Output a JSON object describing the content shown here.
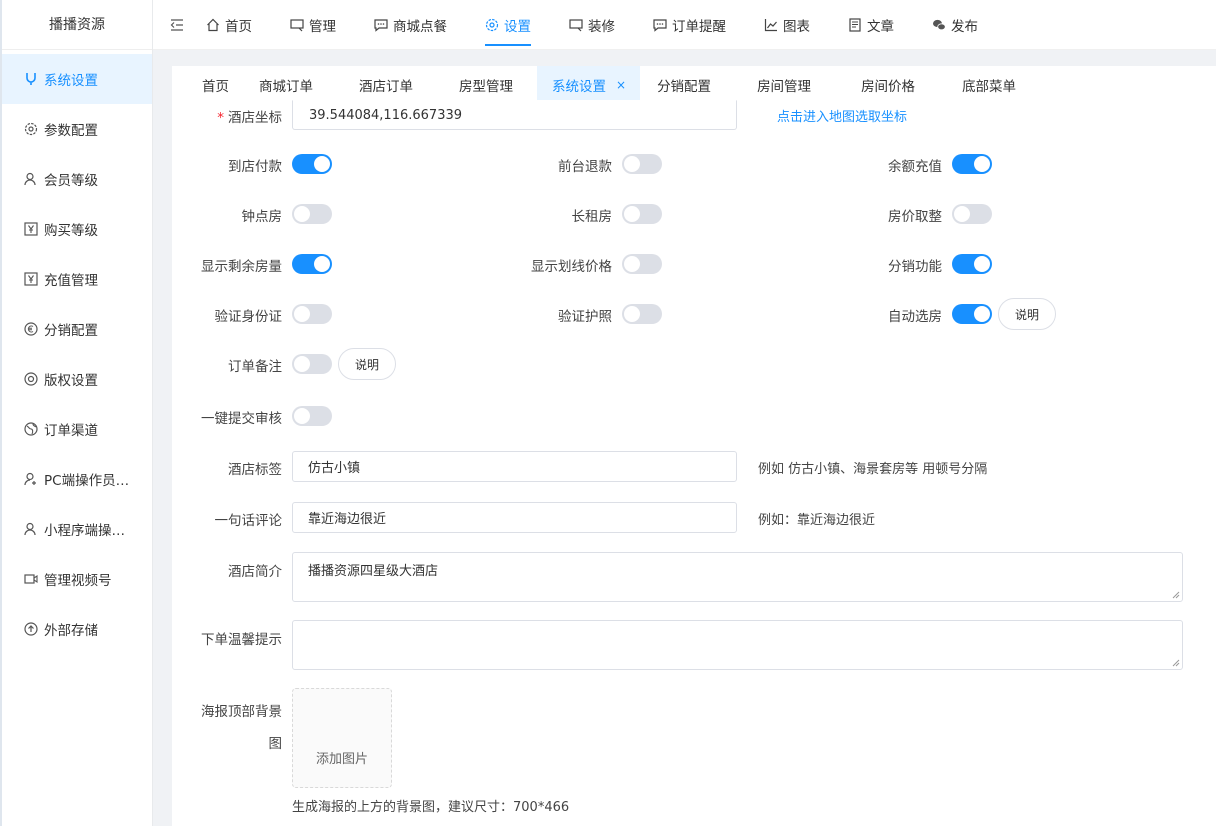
{
  "brand": "播播资源",
  "sidebar": {
    "items": [
      {
        "label": "系统设置",
        "icon": "tuning-fork-icon",
        "active": true
      },
      {
        "label": "参数配置",
        "icon": "gear-icon"
      },
      {
        "label": "会员等级",
        "icon": "user-icon"
      },
      {
        "label": "购买等级",
        "icon": "yen-box-icon"
      },
      {
        "label": "充值管理",
        "icon": "yen-box-icon"
      },
      {
        "label": "分销配置",
        "icon": "euro-circle-icon"
      },
      {
        "label": "版权设置",
        "icon": "copyright-icon"
      },
      {
        "label": "订单渠道",
        "icon": "globe-icon"
      },
      {
        "label": "PC端操作员管理",
        "icon": "user-add-icon"
      },
      {
        "label": "小程序端操作员管理",
        "icon": "user-icon"
      },
      {
        "label": "管理视频号",
        "icon": "video-icon"
      },
      {
        "label": "外部存储",
        "icon": "cloud-upload-icon"
      }
    ]
  },
  "topnav": {
    "items": [
      {
        "label": "首页",
        "icon": "home-icon"
      },
      {
        "label": "管理",
        "icon": "monitor-icon"
      },
      {
        "label": "商城点餐",
        "icon": "chat-icon"
      },
      {
        "label": "设置",
        "icon": "gear-icon",
        "active": true
      },
      {
        "label": "装修",
        "icon": "monitor-icon"
      },
      {
        "label": "订单提醒",
        "icon": "chat-icon"
      },
      {
        "label": "图表",
        "icon": "chart-icon"
      },
      {
        "label": "文章",
        "icon": "document-icon"
      },
      {
        "label": "发布",
        "icon": "wechat-icon"
      }
    ]
  },
  "tabs": [
    {
      "label": "首页"
    },
    {
      "label": "商城订单"
    },
    {
      "label": "酒店订单"
    },
    {
      "label": "房型管理"
    },
    {
      "label": "系统设置",
      "active": true,
      "close": "×"
    },
    {
      "label": "分销配置"
    },
    {
      "label": "房间管理"
    },
    {
      "label": "房间价格"
    },
    {
      "label": "底部菜单"
    }
  ],
  "form": {
    "coord": {
      "label": "酒店坐标",
      "required_mark": "*",
      "value": "39.544084,116.667339",
      "link": "点击进入地图选取坐标"
    },
    "switches": [
      {
        "label": "到店付款",
        "on": true
      },
      {
        "label": "前台退款",
        "on": false
      },
      {
        "label": "余额充值",
        "on": true
      },
      {
        "label": "钟点房",
        "on": false
      },
      {
        "label": "长租房",
        "on": false
      },
      {
        "label": "房价取整",
        "on": false
      },
      {
        "label": "显示剩余房量",
        "on": true
      },
      {
        "label": "显示划线价格",
        "on": false
      },
      {
        "label": "分销功能",
        "on": true
      },
      {
        "label": "验证身份证",
        "on": false
      },
      {
        "label": "验证护照",
        "on": false
      },
      {
        "label": "自动选房",
        "on": true
      },
      {
        "label": "订单备注",
        "on": false
      },
      {
        "label": "一键提交审核",
        "on": false
      }
    ],
    "explain_label": "说明",
    "tag": {
      "label": "酒店标签",
      "value": "仿古小镇",
      "hint": "例如 仿古小镇、海景套房等 用顿号分隔"
    },
    "comment": {
      "label": "一句话评论",
      "value": "靠近海边很近",
      "hint": "例如：靠近海边很近"
    },
    "intro": {
      "label": "酒店简介",
      "value": "播播资源四星级大酒店"
    },
    "notice": {
      "label": "下单温馨提示",
      "value": ""
    },
    "poster": {
      "label_line1": "海报顶部背景",
      "label_line2": "图",
      "upload": "添加图片",
      "hint": "生成海报的上方的背景图，建议尺寸：700*466"
    }
  },
  "colors": {
    "accent": "#1890ff",
    "active_bg": "#e8f4ff",
    "switch_off": "#dcdfe6"
  }
}
